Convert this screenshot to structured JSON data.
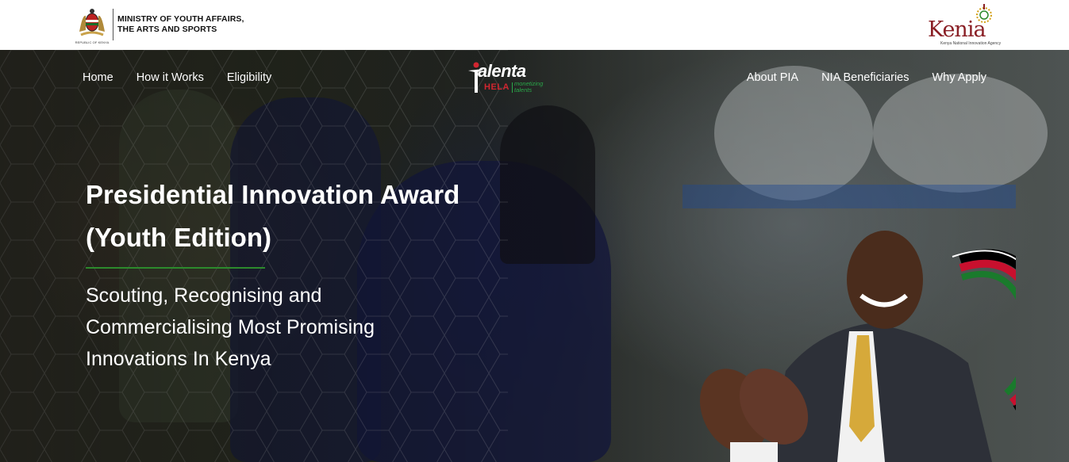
{
  "header": {
    "ministry_line1": "MINISTRY OF YOUTH AFFAIRS,",
    "ministry_line2": "THE ARTS AND SPORTS",
    "coat_caption": "REPUBLIC OF KENYA",
    "kenia_brand": "Kenia",
    "kenia_subtitle": "Kenya National Innovation Agency"
  },
  "nav": {
    "left": [
      "Home",
      "How it Works",
      "Eligibility"
    ],
    "right": [
      "About PIA",
      "NIA Beneficiaries",
      "Why Apply"
    ]
  },
  "talenta": {
    "word": "alenta",
    "hela": "HELA",
    "tagline_1": "monetizing",
    "tagline_2": "talents"
  },
  "hero": {
    "title_line1": "Presidential Innovation Award",
    "title_line2": "(Youth Edition)",
    "sub_line1": "Scouting, Recognising and",
    "sub_line2": "Commercialising Most Promising",
    "sub_line3": "Innovations In Kenya"
  },
  "colors": {
    "accent_green": "#2c8a2c",
    "kenia_red": "#8a1f25",
    "hela_red": "#d22630"
  }
}
